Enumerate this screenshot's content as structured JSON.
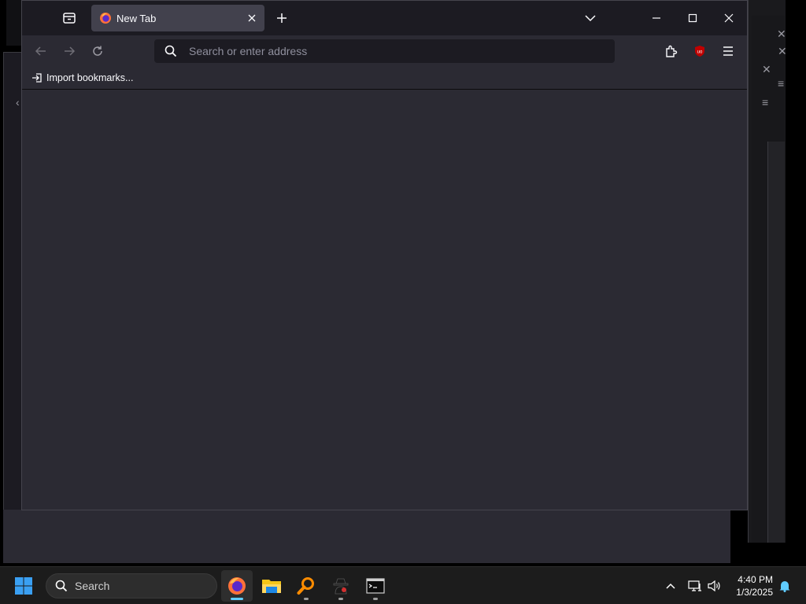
{
  "browser": {
    "tab": {
      "title": "New Tab"
    },
    "urlbar": {
      "placeholder": "Search or enter address"
    },
    "bookmarks": {
      "import_label": "Import bookmarks..."
    }
  },
  "taskbar": {
    "search_label": "Search",
    "clock": {
      "time": "4:40 PM",
      "date": "1/3/2025"
    },
    "apps": [
      {
        "name": "firefox-icon",
        "active": true
      },
      {
        "name": "file-explorer-icon",
        "active": false
      },
      {
        "name": "search-tool-icon",
        "active": false
      },
      {
        "name": "spy-app-icon",
        "active": false
      },
      {
        "name": "terminal-icon",
        "active": false
      }
    ]
  },
  "colors": {
    "accent": "#0078d4",
    "browser_bg": "#2b2a33",
    "titlebar_bg": "#1c1b22",
    "tab_active_bg": "#42414d",
    "ublock_red": "#c00000",
    "taskbar_indicator": "#60cdff"
  }
}
